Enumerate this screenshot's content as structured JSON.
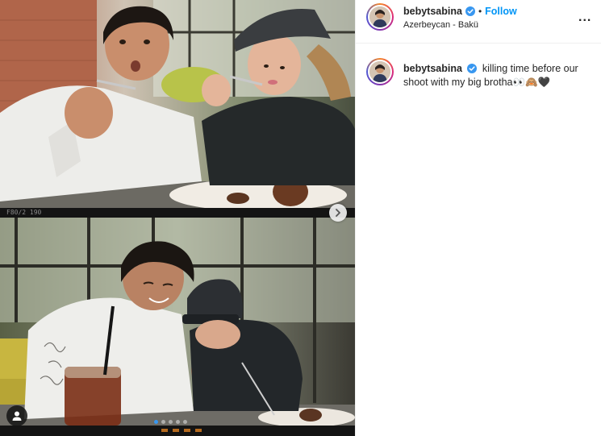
{
  "post": {
    "username": "bebytsabina",
    "separator": "•",
    "follow_label": "Follow",
    "location": "Azerbeycan - Bakü",
    "more_label": "..."
  },
  "caption": {
    "username": "bebytsabina",
    "text": "killing time before our shoot with my big brotha👀🙈🖤"
  },
  "media": {
    "top_strip_text": "F80/2   190",
    "carousel_count": 5,
    "carousel_active": 1
  },
  "colors": {
    "follow_blue": "#0095f6",
    "verified_blue": "#3897f0",
    "carousel_active": "#3897f0"
  },
  "icons": [
    "verified-badge-icon",
    "chevron-right-icon",
    "user-tag-icon",
    "more-options-icon"
  ]
}
